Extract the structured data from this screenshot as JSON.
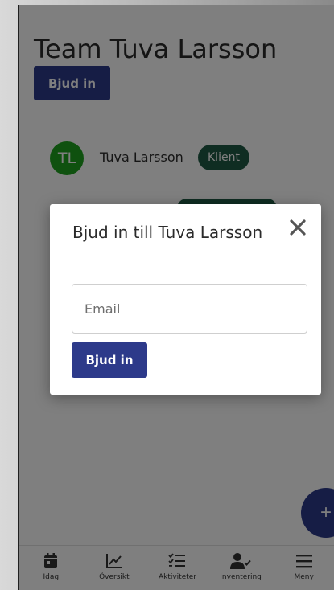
{
  "page": {
    "title": "Team Tuva Larsson",
    "invite_label": "Bjud in"
  },
  "members": [
    {
      "initials": "TL",
      "name": "Tuva Larsson",
      "badge": "Klient",
      "avatar_color": "#1fa31f"
    }
  ],
  "colors": {
    "primary": "#2d3a8a",
    "badge": "#1f5a44"
  },
  "fab": {
    "icon": "plus-icon",
    "label": "+"
  },
  "bottom_nav": [
    {
      "label": "Idag",
      "icon": "calendar-icon"
    },
    {
      "label": "Översikt",
      "icon": "chart-icon"
    },
    {
      "label": "Aktiviteter",
      "icon": "checklist-icon"
    },
    {
      "label": "Inventering",
      "icon": "person-check-icon"
    },
    {
      "label": "Meny",
      "icon": "menu-icon"
    }
  ],
  "modal": {
    "title": "Bjud in till Tuva Larsson",
    "email_placeholder": "Email",
    "email_value": "",
    "submit_label": "Bjud in",
    "close_icon": "close-icon"
  }
}
